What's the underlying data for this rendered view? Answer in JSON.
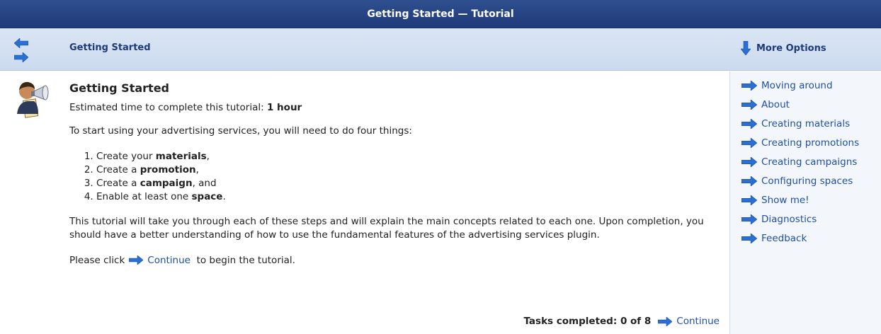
{
  "titlebar": {
    "title": "Getting Started — Tutorial"
  },
  "navbar": {
    "breadcrumb": "Getting Started",
    "more_options_label": "More Options"
  },
  "main": {
    "heading": "Getting Started",
    "estimate_prefix": "Estimated time to complete this tutorial: ",
    "estimate_value": "1 hour",
    "intro": "To start using your advertising services, you will need to do four things:",
    "steps": [
      {
        "pre": "Create your ",
        "bold": "materials",
        "post": ","
      },
      {
        "pre": "Create a ",
        "bold": "promotion",
        "post": ","
      },
      {
        "pre": "Create a ",
        "bold": "campaign",
        "post": ", and"
      },
      {
        "pre": "Enable at least one ",
        "bold": "space",
        "post": "."
      }
    ],
    "description": "This tutorial will take you through each of these steps and will explain the main concepts related to each one. Upon completion, you should have a better understanding of how to use the fundamental features of the advertising services plugin.",
    "click_prefix": "Please click",
    "continue_label": "Continue",
    "click_suffix": "to begin the tutorial.",
    "tasks_label": "Tasks completed: 0 of 8",
    "tasks_continue": "Continue"
  },
  "sidebar": {
    "items": [
      "Moving around",
      "About",
      "Creating materials",
      "Creating promotions",
      "Creating campaigns",
      "Configuring spaces",
      "Show me!",
      "Diagnostics",
      "Feedback"
    ]
  },
  "colors": {
    "titlebar": "#1f3a78",
    "navbar": "#cbdaee",
    "link": "#1f4fa6",
    "arrow": "#2a6fd1"
  },
  "icons": {
    "presenter": "presenter-megaphone-icon",
    "back": "arrow-left-icon",
    "forward": "arrow-right-icon",
    "more": "arrow-down-icon",
    "bullet": "arrow-right-icon"
  }
}
